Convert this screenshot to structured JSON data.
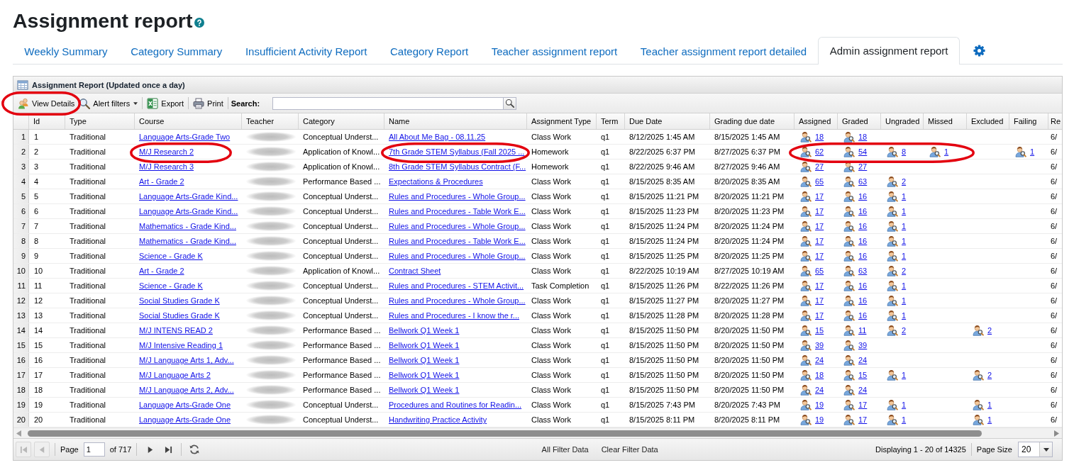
{
  "page": {
    "title": "Assignment report"
  },
  "tabs": [
    {
      "label": "Weekly Summary",
      "selected": false
    },
    {
      "label": "Category Summary",
      "selected": false
    },
    {
      "label": "Insufficient Activity Report",
      "selected": false
    },
    {
      "label": "Category Report",
      "selected": false
    },
    {
      "label": "Teacher assignment report",
      "selected": false
    },
    {
      "label": "Teacher assignment report detailed",
      "selected": false
    },
    {
      "label": "Admin assignment report",
      "selected": true
    }
  ],
  "grid": {
    "title": "Assignment Report (Updated once a day)",
    "toolbar": [
      {
        "kind": "view",
        "label": "View Details",
        "dropdown": false,
        "circled": true
      },
      {
        "kind": "filter",
        "label": "Alert filters",
        "dropdown": true,
        "circled": false
      },
      {
        "kind": "export",
        "label": "Export",
        "dropdown": false,
        "circled": false
      },
      {
        "kind": "print",
        "label": "Print",
        "dropdown": false,
        "circled": false
      }
    ],
    "search": {
      "label": "Search:"
    },
    "columns": [
      {
        "label": "Id",
        "kind": "text"
      },
      {
        "label": "Type",
        "kind": "text"
      },
      {
        "label": "Course",
        "kind": "link"
      },
      {
        "label": "Teacher",
        "kind": "redacted"
      },
      {
        "label": "Category",
        "kind": "text"
      },
      {
        "label": "Name",
        "kind": "link"
      },
      {
        "label": "Assignment Type",
        "kind": "text"
      },
      {
        "label": "Term",
        "kind": "text"
      },
      {
        "label": "Due Date",
        "kind": "text"
      },
      {
        "label": "Grading due date",
        "kind": "text"
      },
      {
        "label": "Assigned",
        "kind": "count"
      },
      {
        "label": "Graded",
        "kind": "count"
      },
      {
        "label": "Ungraded",
        "kind": "count"
      },
      {
        "label": "Missed",
        "kind": "count"
      },
      {
        "label": "Excluded",
        "kind": "count"
      },
      {
        "label": "Failing",
        "kind": "count"
      },
      {
        "label": "Re",
        "kind": "text"
      }
    ],
    "rows": [
      {
        "number": "1",
        "id": "1",
        "type": "Traditional",
        "course": "Language Arts-Grade Two",
        "category": "Conceptual Underst...",
        "name": "All About Me Bag - 08.11.25",
        "assignment_type": "Class Work",
        "term": "q1",
        "due_date": "8/12/2025 1:45 AM",
        "grading_due_date": "8/15/2025 1:45 AM",
        "assigned": "18",
        "graded": "18",
        "column_18": "6/"
      },
      {
        "number": "2",
        "id": "2",
        "type": "Traditional",
        "course": "M/J Research 2",
        "category": "Application of Knowl...",
        "name": "7th Grade STEM Syllabus (Fall 2025 ...",
        "assignment_type": "Homework",
        "term": "q1",
        "due_date": "8/22/2025 6:37 PM",
        "grading_due_date": "8/27/2025 6:37 PM",
        "assigned": "62",
        "graded": "54",
        "ungraded": "8",
        "missed": "1",
        "failing": "1",
        "column_18": "6/",
        "course_circled": true,
        "name_circled": true,
        "counts_circled": true
      },
      {
        "number": "3",
        "id": "3",
        "type": "Traditional",
        "course": "M/J Research 3",
        "category": "Application of Knowl...",
        "name": "8th Grade STEM Syllabus Contract (F...",
        "assignment_type": "Homework",
        "term": "q1",
        "due_date": "8/22/2025 9:46 AM",
        "grading_due_date": "8/27/2025 9:46 AM",
        "assigned": "27",
        "graded": "27",
        "column_18": "6/"
      },
      {
        "number": "4",
        "id": "4",
        "type": "Traditional",
        "course": "Art - Grade 2",
        "category": "Performance Based ...",
        "name": "Expectations & Procedures",
        "assignment_type": "Class Work",
        "term": "q1",
        "due_date": "8/15/2025 8:35 AM",
        "grading_due_date": "8/20/2025 8:35 AM",
        "assigned": "65",
        "graded": "63",
        "ungraded": "2",
        "column_18": "6/"
      },
      {
        "number": "5",
        "id": "5",
        "type": "Traditional",
        "course": "Language Arts-Grade Kind...",
        "category": "Conceptual Underst...",
        "name": "Rules and Procedures - Whole Group...",
        "assignment_type": "Class Work",
        "term": "q1",
        "due_date": "8/15/2025 11:21 PM",
        "grading_due_date": "8/20/2025 11:21 PM",
        "assigned": "17",
        "graded": "16",
        "ungraded": "1",
        "column_18": "6/"
      },
      {
        "number": "6",
        "id": "6",
        "type": "Traditional",
        "course": "Language Arts-Grade Kind...",
        "category": "Conceptual Underst...",
        "name": "Rules and Procedures - Table Work E...",
        "assignment_type": "Class Work",
        "term": "q1",
        "due_date": "8/15/2025 11:23 PM",
        "grading_due_date": "8/20/2025 11:23 PM",
        "assigned": "17",
        "graded": "16",
        "ungraded": "1",
        "column_18": "6/"
      },
      {
        "number": "7",
        "id": "7",
        "type": "Traditional",
        "course": "Mathematics - Grade Kind...",
        "category": "Conceptual Underst...",
        "name": "Rules and Procedures - Whole Group...",
        "assignment_type": "Class Work",
        "term": "q1",
        "due_date": "8/15/2025 11:24 PM",
        "grading_due_date": "8/20/2025 11:24 PM",
        "assigned": "17",
        "graded": "16",
        "ungraded": "1",
        "column_18": "6/"
      },
      {
        "number": "8",
        "id": "8",
        "type": "Traditional",
        "course": "Mathematics - Grade Kind...",
        "category": "Conceptual Underst...",
        "name": "Rules and Procedures - Table Work E...",
        "assignment_type": "Class Work",
        "term": "q1",
        "due_date": "8/15/2025 11:24 PM",
        "grading_due_date": "8/20/2025 11:24 PM",
        "assigned": "17",
        "graded": "16",
        "ungraded": "1",
        "column_18": "6/"
      },
      {
        "number": "9",
        "id": "9",
        "type": "Traditional",
        "course": "Science - Grade K",
        "category": "Conceptual Underst...",
        "name": "Rules and Procedures - Whole Group...",
        "assignment_type": "Class Work",
        "term": "q1",
        "due_date": "8/15/2025 11:25 PM",
        "grading_due_date": "8/20/2025 11:25 PM",
        "assigned": "17",
        "graded": "16",
        "ungraded": "1",
        "column_18": "6/"
      },
      {
        "number": "10",
        "id": "10",
        "type": "Traditional",
        "course": "Art - Grade 2",
        "category": "Application of Knowl...",
        "name": "Contract Sheet",
        "assignment_type": "Class Work",
        "term": "q1",
        "due_date": "8/22/2025 10:19 AM",
        "grading_due_date": "8/27/2025 10:19 AM",
        "assigned": "65",
        "graded": "63",
        "ungraded": "2",
        "column_18": "6/"
      },
      {
        "number": "11",
        "id": "11",
        "type": "Traditional",
        "course": "Science - Grade K",
        "category": "Conceptual Underst...",
        "name": "Rules and Procedures - STEM Activit...",
        "assignment_type": "Task Completion",
        "term": "q1",
        "due_date": "8/15/2025 11:26 PM",
        "grading_due_date": "8/22/2025 11:26 PM",
        "assigned": "17",
        "graded": "16",
        "ungraded": "1",
        "column_18": "6/"
      },
      {
        "number": "12",
        "id": "12",
        "type": "Traditional",
        "course": "Social Studies Grade K",
        "category": "Conceptual Underst...",
        "name": "Rules and Procedures - Whole Group...",
        "assignment_type": "Class Work",
        "term": "q1",
        "due_date": "8/15/2025 11:27 PM",
        "grading_due_date": "8/20/2025 11:27 PM",
        "assigned": "17",
        "graded": "16",
        "ungraded": "1",
        "column_18": "6/"
      },
      {
        "number": "13",
        "id": "13",
        "type": "Traditional",
        "course": "Social Studies Grade K",
        "category": "Conceptual Underst...",
        "name": "Rules and Procedures - I know the r...",
        "assignment_type": "Class Work",
        "term": "q1",
        "due_date": "8/15/2025 11:28 PM",
        "grading_due_date": "8/20/2025 11:28 PM",
        "assigned": "17",
        "graded": "16",
        "ungraded": "1",
        "column_18": "6/"
      },
      {
        "number": "14",
        "id": "14",
        "type": "Traditional",
        "course": "M/J INTENS READ 2",
        "category": "Performance Based ...",
        "name": "Bellwork Q1 Week 1",
        "assignment_type": "Class Work",
        "term": "q1",
        "due_date": "8/15/2025 11:50 PM",
        "grading_due_date": "8/20/2025 11:50 PM",
        "assigned": "15",
        "graded": "11",
        "ungraded": "2",
        "excluded": "2",
        "column_18": "6/"
      },
      {
        "number": "15",
        "id": "15",
        "type": "Traditional",
        "course": "M/J Intensive Reading 1",
        "category": "Performance Based ...",
        "name": "Bellwork Q1 Week 1",
        "assignment_type": "Class Work",
        "term": "q1",
        "due_date": "8/15/2025 11:50 PM",
        "grading_due_date": "8/20/2025 11:50 PM",
        "assigned": "39",
        "graded": "39",
        "column_18": "6/"
      },
      {
        "number": "16",
        "id": "16",
        "type": "Traditional",
        "course": "M/J Language Arts 1, Adv...",
        "category": "Performance Based ...",
        "name": "Bellwork Q1 Week 1",
        "assignment_type": "Class Work",
        "term": "q1",
        "due_date": "8/15/2025 11:50 PM",
        "grading_due_date": "8/20/2025 11:50 PM",
        "assigned": "24",
        "graded": "24",
        "column_18": "6/"
      },
      {
        "number": "17",
        "id": "17",
        "type": "Traditional",
        "course": "M/J Language Arts 2",
        "category": "Performance Based ...",
        "name": "Bellwork Q1 Week 1",
        "assignment_type": "Class Work",
        "term": "q1",
        "due_date": "8/15/2025 11:50 PM",
        "grading_due_date": "8/20/2025 11:50 PM",
        "assigned": "18",
        "graded": "15",
        "ungraded": "1",
        "excluded": "2",
        "column_18": "6/"
      },
      {
        "number": "18",
        "id": "18",
        "type": "Traditional",
        "course": "M/J Language Arts 2, Adv...",
        "category": "Performance Based ...",
        "name": "Bellwork Q1 Week 1",
        "assignment_type": "Class Work",
        "term": "q1",
        "due_date": "8/15/2025 11:50 PM",
        "grading_due_date": "8/20/2025 11:50 PM",
        "assigned": "24",
        "graded": "24",
        "column_18": "6/"
      },
      {
        "number": "19",
        "id": "19",
        "type": "Traditional",
        "course": "Language Arts-Grade One",
        "category": "Conceptual Underst...",
        "name": "Procedures and Routines for Readin...",
        "assignment_type": "Class Work",
        "term": "q1",
        "due_date": "8/15/2025 7:43 PM",
        "grading_due_date": "8/20/2025 7:43 PM",
        "assigned": "19",
        "graded": "17",
        "ungraded": "1",
        "excluded": "1",
        "column_18": "6/"
      },
      {
        "number": "20",
        "id": "20",
        "type": "Traditional",
        "course": "Language Arts-Grade One",
        "category": "Conceptual Underst...",
        "name": "Handwriting Practice Activity",
        "assignment_type": "Class Work",
        "term": "q1",
        "due_date": "8/15/2025 8:11 PM",
        "grading_due_date": "8/20/2025 8:11 PM",
        "assigned": "19",
        "graded": "17",
        "ungraded": "1",
        "excluded": "1",
        "column_18": "6/"
      }
    ],
    "pager": {
      "nav": [
        {
          "kind": "first",
          "disabled": true
        },
        {
          "kind": "previous",
          "disabled": true
        }
      ],
      "label": "Page",
      "page": "1",
      "total": "of 717",
      "nav_after": [
        {
          "kind": "next",
          "disabled": false
        },
        {
          "kind": "last",
          "disabled": false
        }
      ],
      "filters": [
        "All Filter Data",
        "Clear Filter Data"
      ],
      "display": "Displaying 1 - 20 of 14325",
      "page_size": {
        "label": "Page Size",
        "value": "20"
      }
    }
  }
}
